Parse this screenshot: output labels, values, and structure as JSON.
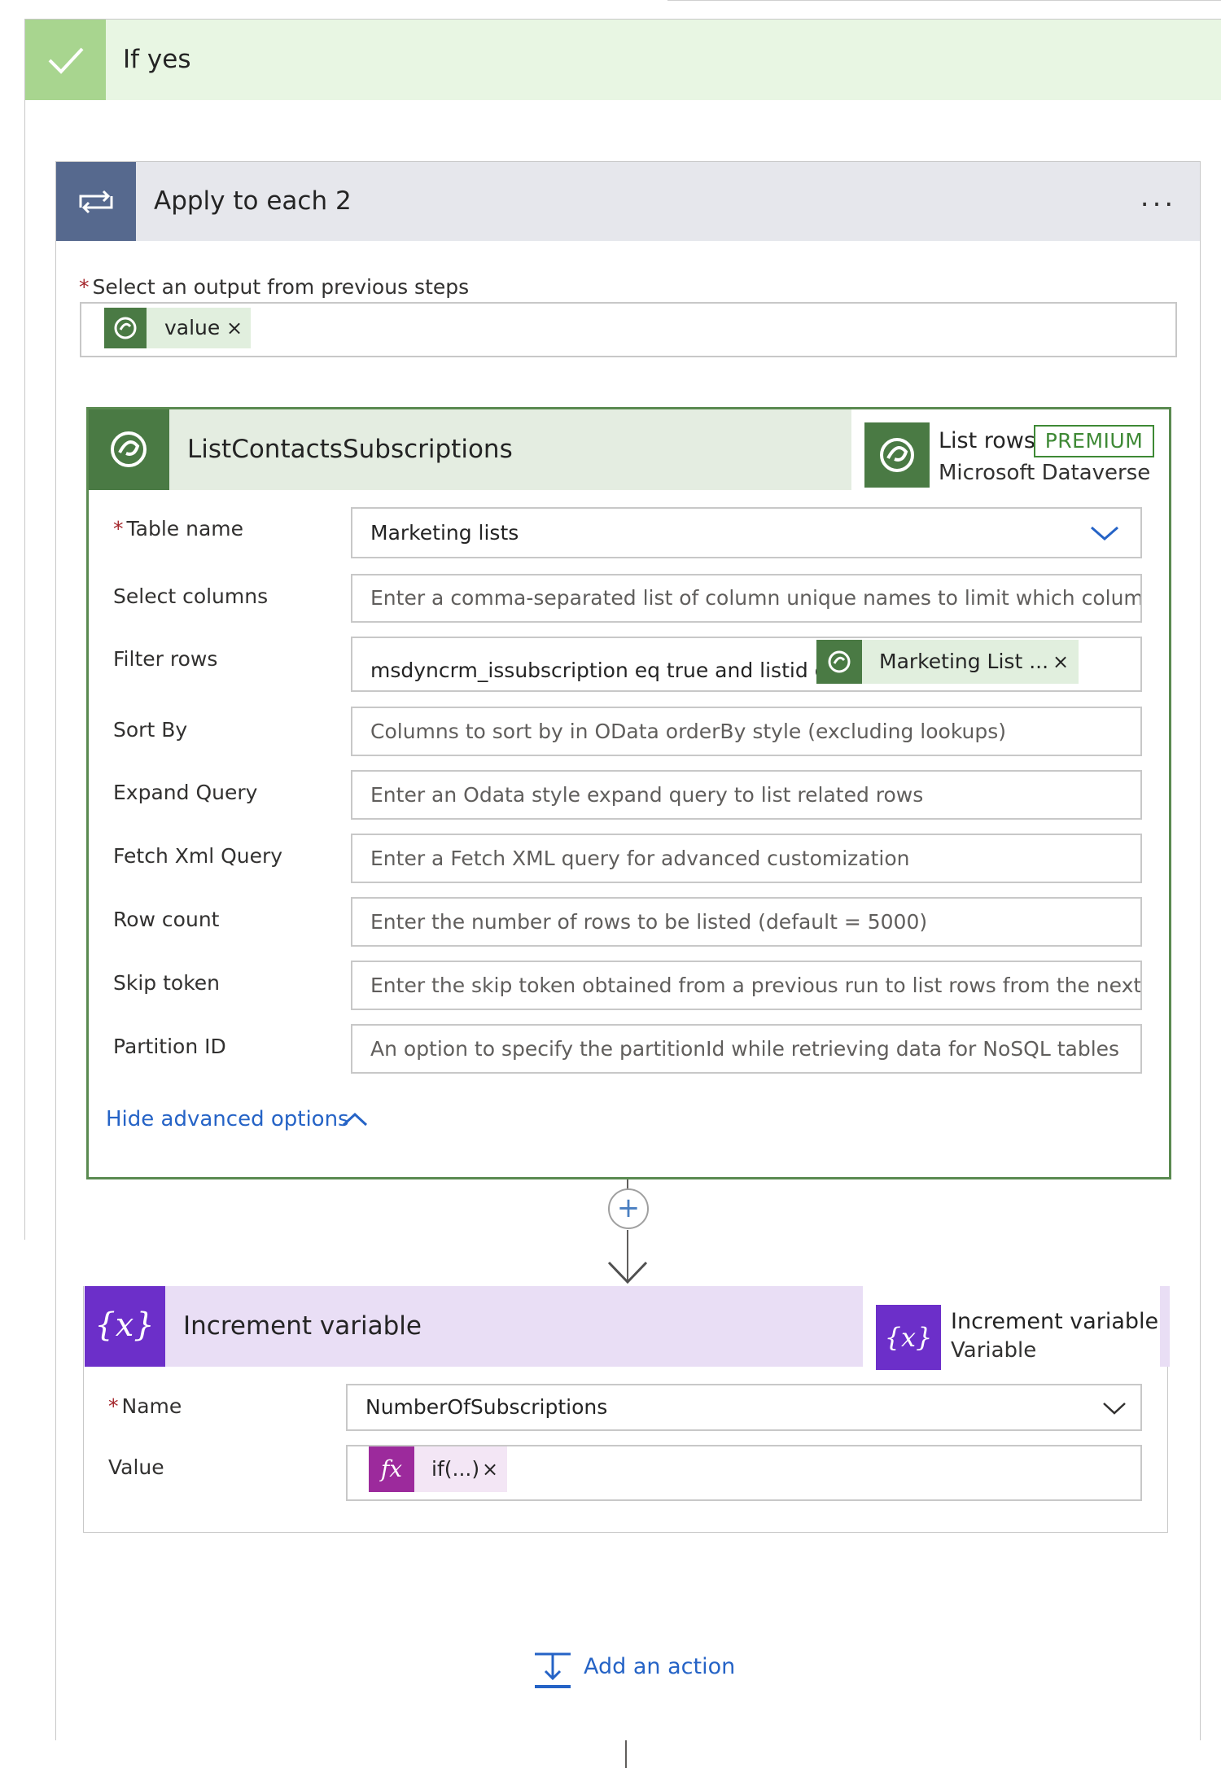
{
  "if_yes": {
    "title": "If yes"
  },
  "apply_each": {
    "title": "Apply to each 2",
    "more_label": "...",
    "select_label": "Select an output from previous steps",
    "required_mark": "*",
    "token": {
      "label": "value",
      "remove": "×"
    }
  },
  "list_rows": {
    "title": "ListContactsSubscriptions",
    "connector": {
      "name": "List rows",
      "badge": "PREMIUM",
      "provider": "Microsoft Dataverse"
    },
    "fields": {
      "table_name": {
        "label": "Table name",
        "value": "Marketing lists"
      },
      "select_columns": {
        "label": "Select columns",
        "placeholder": "Enter a comma-separated list of column unique names to limit which columns a"
      },
      "filter_rows": {
        "label": "Filter rows",
        "value": "msdyncrm_issubscription eq true and listid eq",
        "token": "Marketing List ...",
        "token_remove": "×"
      },
      "sort_by": {
        "label": "Sort By",
        "placeholder": "Columns to sort by in OData orderBy style (excluding lookups)"
      },
      "expand_query": {
        "label": "Expand Query",
        "placeholder": "Enter an Odata style expand query to list related rows"
      },
      "fetch_xml": {
        "label": "Fetch Xml Query",
        "placeholder": "Enter a Fetch XML query for advanced customization"
      },
      "row_count": {
        "label": "Row count",
        "placeholder": "Enter the number of rows to be listed (default = 5000)"
      },
      "skip_token": {
        "label": "Skip token",
        "placeholder": "Enter the skip token obtained from a previous run to list rows from the next pa"
      },
      "partition_id": {
        "label": "Partition ID",
        "placeholder": "An option to specify the partitionId while retrieving data for NoSQL tables"
      }
    },
    "hide_advanced": "Hide advanced options"
  },
  "increment_variable": {
    "title": "Increment variable",
    "connector": {
      "name": "Increment variable",
      "provider": "Variable"
    },
    "fields": {
      "name": {
        "label": "Name",
        "value": "NumberOfSubscriptions"
      },
      "value": {
        "label": "Value",
        "token": "if(...)",
        "token_remove": "×"
      }
    }
  },
  "add_action": {
    "label": "Add an action"
  },
  "connector_plus": "+",
  "icons": {
    "if_yes": "checkmark-icon",
    "apply_each": "loop-icon",
    "dataverse": "dataverse-icon",
    "variable": "variable-icon",
    "expression": "fx-icon",
    "add_action": "add-action-icon"
  },
  "colors": {
    "if_yes_header": "#e8f6e3",
    "if_yes_icon": "#a8d58f",
    "apply_icon": "#56698e",
    "dataverse_green": "#4a7a44",
    "premium_green": "#3e8935",
    "variable_purple": "#6c2fc9",
    "expression_magenta": "#9c2a9c",
    "link_blue": "#2563c6"
  }
}
